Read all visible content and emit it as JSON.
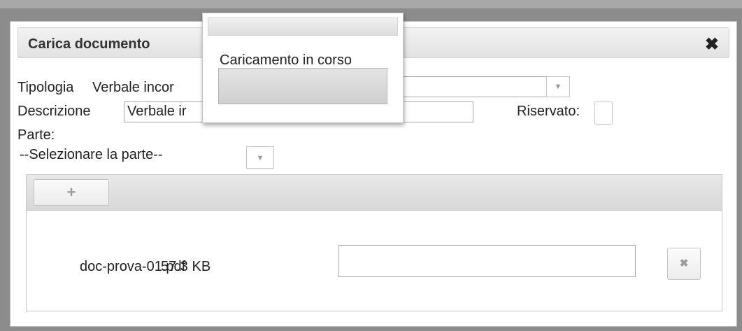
{
  "dialog": {
    "title": "Carica documento",
    "close_glyph": "✖"
  },
  "form": {
    "tipologia_label": "Tipologia",
    "tipologia_value": "Verbale incor",
    "descrizione_label": "Descrizione",
    "descrizione_value": "Verbale ir",
    "riservato_label": "Riservato:",
    "riservato_checked": false,
    "parte_label": "Parte:",
    "parte_value": "--Selezionare la parte--",
    "dropdown_glyph": "▼"
  },
  "upload": {
    "add_glyph": "+",
    "files": [
      {
        "name": "doc-prova-01.pdf",
        "size": "57.3 KB",
        "description": ""
      }
    ],
    "remove_glyph": "✖"
  },
  "progress_popup": {
    "text": "Caricamento in corso",
    "progress": 0
  },
  "colors": {
    "overlay": "#8c8c8c",
    "dialog_bg": "#ffffff",
    "toolbar_bg": "#dedede"
  },
  "icons": {
    "close": "close-icon",
    "dropdown": "chevron-down-icon",
    "add": "plus-icon",
    "remove": "close-icon"
  }
}
